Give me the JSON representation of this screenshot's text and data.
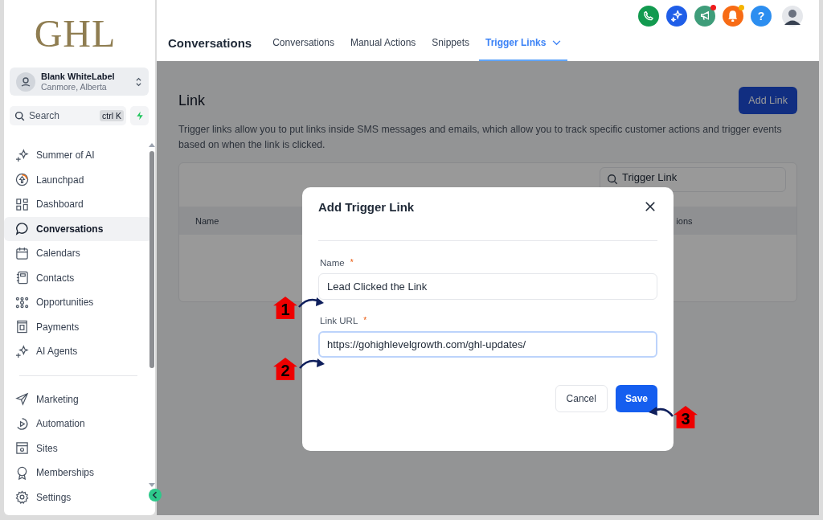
{
  "sidebar": {
    "logo": "GHL",
    "account": {
      "name": "Blank WhiteLabel",
      "location": "Canmore, Alberta"
    },
    "search": {
      "placeholder": "Search",
      "shortcut": "ctrl K"
    },
    "nav_groups": [
      [
        {
          "label": "Summer of AI",
          "selected": false
        },
        {
          "label": "Launchpad",
          "selected": false
        },
        {
          "label": "Dashboard",
          "selected": false
        },
        {
          "label": "Conversations",
          "selected": true
        },
        {
          "label": "Calendars",
          "selected": false
        },
        {
          "label": "Contacts",
          "selected": false
        },
        {
          "label": "Opportunities",
          "selected": false
        },
        {
          "label": "Payments",
          "selected": false
        },
        {
          "label": "AI Agents",
          "selected": false
        }
      ],
      [
        {
          "label": "Marketing",
          "selected": false
        },
        {
          "label": "Automation",
          "selected": false
        },
        {
          "label": "Sites",
          "selected": false
        },
        {
          "label": "Memberships",
          "selected": false
        },
        {
          "label": "Settings",
          "selected": false
        }
      ]
    ]
  },
  "header": {
    "actions": [
      {
        "kind": "phone"
      },
      {
        "kind": "sparkle"
      },
      {
        "kind": "megaphone",
        "notification": true
      },
      {
        "kind": "bell",
        "notification": true
      },
      {
        "kind": "help",
        "label": "?"
      },
      {
        "kind": "avatar"
      }
    ],
    "title": "Conversations",
    "tabs": [
      {
        "label": "Conversations",
        "selected": false,
        "has_menu": false
      },
      {
        "label": "Manual Actions",
        "selected": false,
        "has_menu": false
      },
      {
        "label": "Snippets",
        "selected": false,
        "has_menu": false
      },
      {
        "label": "Trigger Links",
        "selected": true,
        "has_menu": true
      }
    ]
  },
  "content": {
    "title": "Link",
    "add_button": "Add Link",
    "description": "Trigger links allow you to put links inside SMS messages and emails, which allow you to track specific customer actions and trigger events based on when the link is clicked.",
    "table": {
      "search_placeholder": "Trigger Link",
      "columns": [
        "Name",
        "ions"
      ]
    }
  },
  "modal": {
    "title": "Add Trigger Link",
    "fields": [
      {
        "label": "Name",
        "required_mark": "*",
        "value": "Lead Clicked the Link",
        "focused": false
      },
      {
        "label": "Link URL",
        "required_mark": "*",
        "value": "https://gohighlevelgrowth.com/ghl-updates/",
        "focused": true
      }
    ],
    "buttons": [
      {
        "label": "Cancel",
        "kind": "secondary"
      },
      {
        "label": "Save",
        "kind": "primary"
      }
    ]
  },
  "annotations": [
    {
      "number": "1"
    },
    {
      "number": "2"
    },
    {
      "number": "3"
    }
  ]
}
